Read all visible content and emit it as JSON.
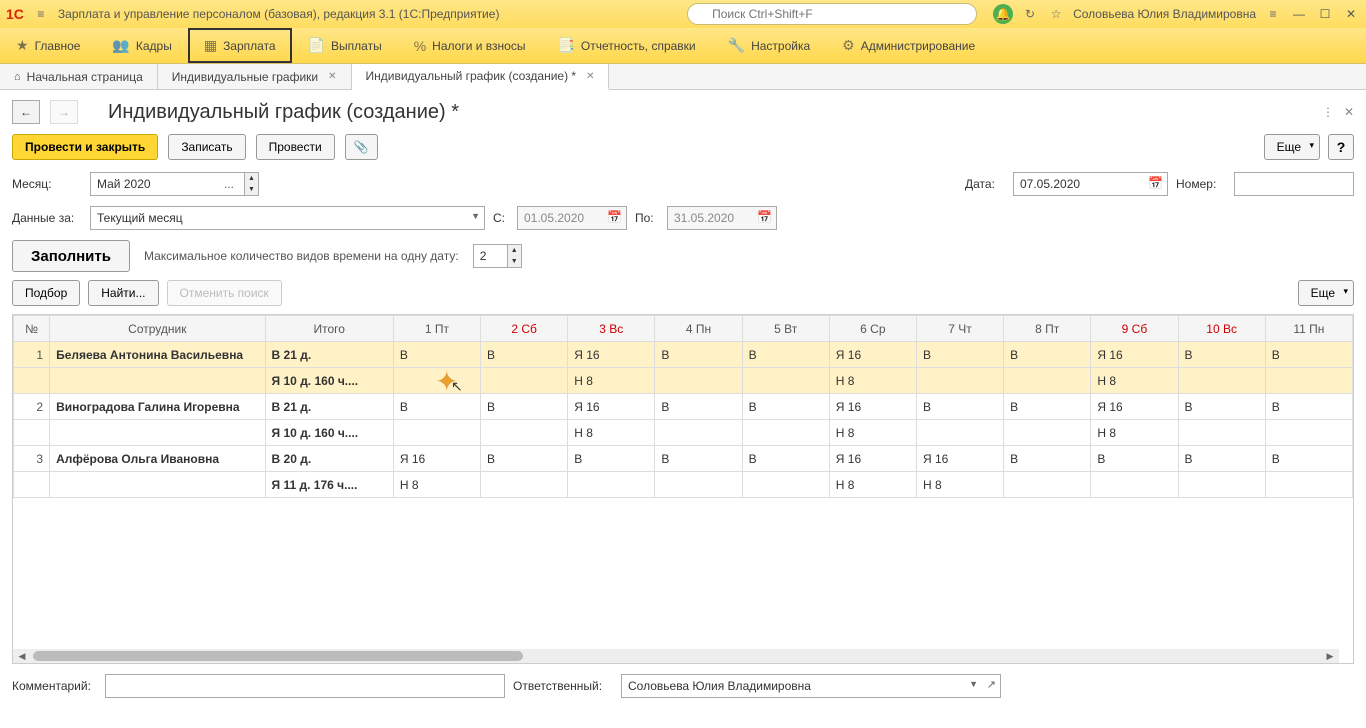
{
  "titlebar": {
    "app_title": "Зарплата и управление персоналом (базовая), редакция 3.1  (1С:Предприятие)",
    "search_placeholder": "Поиск Ctrl+Shift+F",
    "username": "Соловьева Юлия Владимировна"
  },
  "mainnav": [
    {
      "icon": "★",
      "label": "Главное"
    },
    {
      "icon": "👥",
      "label": "Кадры"
    },
    {
      "icon": "▦",
      "label": "Зарплата",
      "active": true
    },
    {
      "icon": "📄",
      "label": "Выплаты"
    },
    {
      "icon": "%",
      "label": "Налоги и взносы"
    },
    {
      "icon": "📑",
      "label": "Отчетность, справки"
    },
    {
      "icon": "🔧",
      "label": "Настройка"
    },
    {
      "icon": "⚙",
      "label": "Администрирование"
    }
  ],
  "tabs": [
    {
      "icon": "⌂",
      "label": "Начальная страница",
      "closable": false
    },
    {
      "icon": "",
      "label": "Индивидуальные графики",
      "closable": true
    },
    {
      "icon": "",
      "label": "Индивидуальный график (создание) *",
      "closable": true,
      "active": true
    }
  ],
  "page": {
    "title": "Индивидуальный график (создание) *",
    "btn_post_close": "Провести и закрыть",
    "btn_save": "Записать",
    "btn_post": "Провести",
    "btn_more": "Еще",
    "help": "?"
  },
  "form": {
    "month_lbl": "Месяц:",
    "month_val": "Май 2020",
    "date_lbl": "Дата:",
    "date_val": "07.05.2020",
    "number_lbl": "Номер:",
    "number_val": "",
    "datafor_lbl": "Данные за:",
    "datafor_val": "Текущий месяц",
    "from_lbl": "С:",
    "from_val": "01.05.2020",
    "to_lbl": "По:",
    "to_val": "31.05.2020",
    "fill_btn": "Заполнить",
    "max_types_lbl": "Максимальное количество видов времени на одну дату:",
    "max_types_val": "2",
    "pick": "Подбор",
    "find": "Найти...",
    "cancel_search": "Отменить поиск",
    "more2": "Еще"
  },
  "table": {
    "headers": [
      "№",
      "Сотрудник",
      "Итого",
      "1 Пт",
      "2 Сб",
      "3 Вс",
      "4 Пн",
      "5 Вт",
      "6 Ср",
      "7 Чт",
      "8 Пт",
      "9 Сб",
      "10 Вс",
      "11 Пн"
    ],
    "weekend_cols": [
      4,
      5,
      11,
      12
    ],
    "rows": [
      {
        "num": "1",
        "emp": "Беляева Антонина Васильевна",
        "total": "В 21 д.",
        "cells": [
          "В",
          "В",
          "Я 16",
          "В",
          "В",
          "Я 16",
          "В",
          "В",
          "Я 16",
          "В",
          "В"
        ],
        "hl": true,
        "editing": 0
      },
      {
        "num": "",
        "emp": "",
        "total": "Я 10 д. 160 ч....",
        "cells": [
          "",
          "",
          "Н 8",
          "",
          "",
          "Н 8",
          "",
          "",
          "Н 8",
          "",
          ""
        ],
        "hl": true
      },
      {
        "num": "2",
        "emp": "Виноградова Галина Игоревна",
        "total": "В 21 д.",
        "cells": [
          "В",
          "В",
          "Я 16",
          "В",
          "В",
          "Я 16",
          "В",
          "В",
          "Я 16",
          "В",
          "В"
        ]
      },
      {
        "num": "",
        "emp": "",
        "total": "Я 10 д. 160 ч....",
        "cells": [
          "",
          "",
          "Н 8",
          "",
          "",
          "Н 8",
          "",
          "",
          "Н 8",
          "",
          ""
        ]
      },
      {
        "num": "3",
        "emp": "Алфёрова Ольга Ивановна",
        "total": "В 20 д.",
        "cells": [
          "Я 16",
          "В",
          "В",
          "В",
          "В",
          "Я 16",
          "Я 16",
          "В",
          "В",
          "В",
          "В"
        ]
      },
      {
        "num": "",
        "emp": "",
        "total": "Я 11 д. 176 ч....",
        "cells": [
          "Н 8",
          "",
          "",
          "",
          "",
          "Н 8",
          "Н 8",
          "",
          "",
          "",
          ""
        ]
      }
    ]
  },
  "footer": {
    "comment_lbl": "Комментарий:",
    "comment_val": "",
    "resp_lbl": "Ответственный:",
    "resp_val": "Соловьева Юлия Владимировна"
  }
}
